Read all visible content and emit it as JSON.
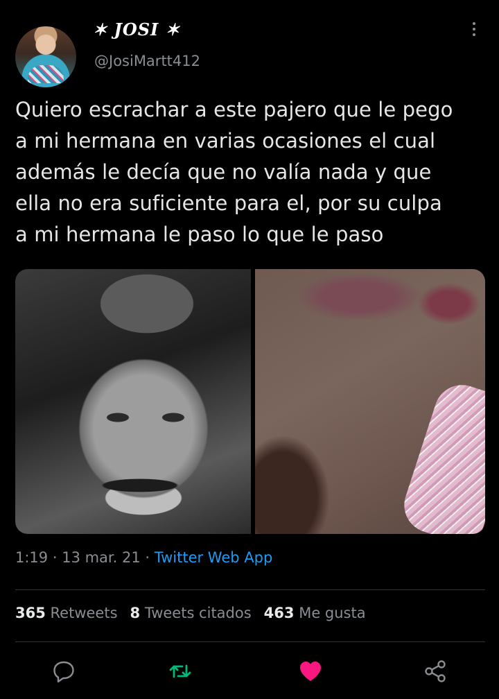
{
  "user": {
    "display_name": "✶ JOSI ✶",
    "handle": "@JosiMartt412"
  },
  "tweet": {
    "lines": [
      "Quiero escrachar a este pajero que le pego",
      "a mi hermana en varias ocasiones el cual",
      "además le decía que no valía nada y que",
      "ella no era suficiente para el, por su culpa",
      "a mi hermana le paso lo que le paso"
    ]
  },
  "meta": {
    "time": "1:19",
    "sep1": " · ",
    "date": "13 mar. 21",
    "sep2": " · ",
    "source": "Twitter Web App"
  },
  "stats": {
    "retweets_count": "365",
    "retweets_label": "Retweets",
    "quotes_count": "8",
    "quotes_label": "Tweets citados",
    "likes_count": "463",
    "likes_label": "Me gusta"
  },
  "icons": {
    "reply": "reply-icon",
    "retweet": "retweet-icon",
    "like": "heart-icon",
    "share": "share-icon",
    "more": "more-vertical-icon"
  },
  "colors": {
    "background": "#000000",
    "accent": "#1d9bf0",
    "retweet_active": "#00ba7c",
    "like_active": "#f91880",
    "secondary_text": "#8a8d91"
  }
}
